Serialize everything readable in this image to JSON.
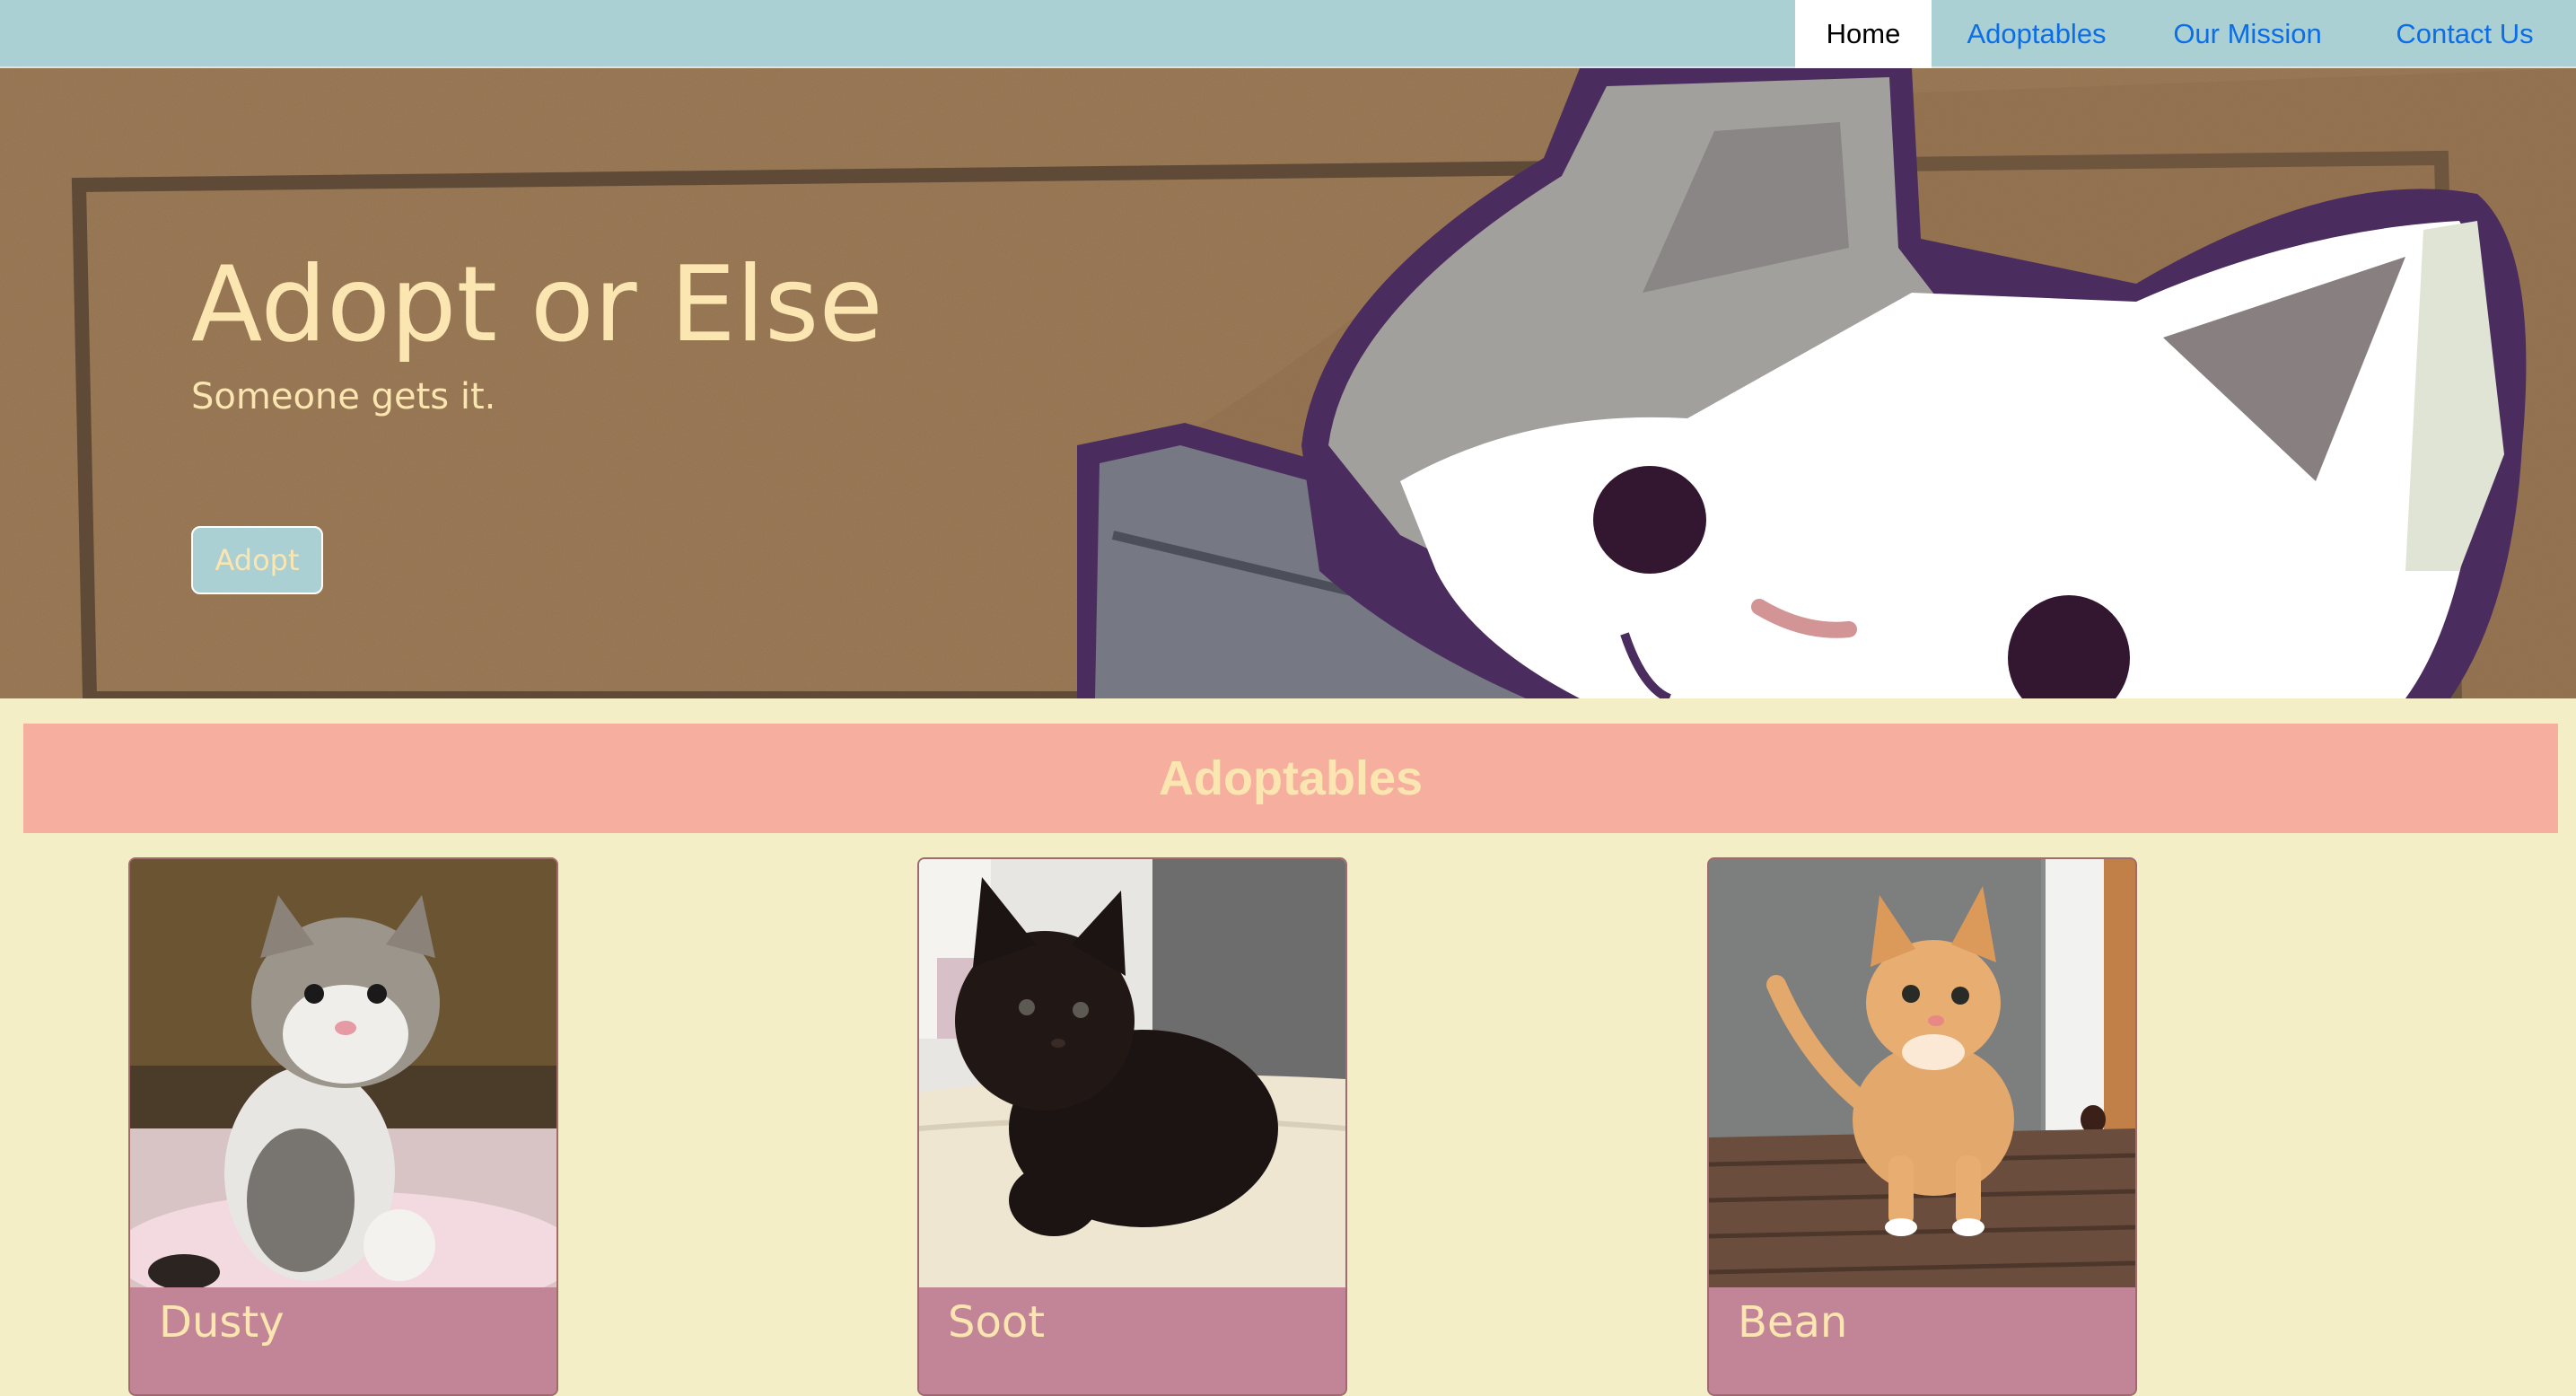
{
  "nav": {
    "items": [
      {
        "label": "Home",
        "active": true
      },
      {
        "label": "Adoptables",
        "active": false
      },
      {
        "label": "Our Mission",
        "active": false
      },
      {
        "label": "Contact Us",
        "active": false
      }
    ]
  },
  "hero": {
    "title": "Adopt or Else",
    "subtitle": "Someone gets it.",
    "button_label": "Adopt"
  },
  "adoptables": {
    "heading": "Adoptables",
    "cards": [
      {
        "name": "Dusty",
        "photo": "kitten-photo-gray-white"
      },
      {
        "name": "Soot",
        "photo": "kitten-photo-black"
      },
      {
        "name": "Bean",
        "photo": "kitten-photo-orange"
      }
    ]
  },
  "colors": {
    "nav_bg": "#abd0d4",
    "page_bg": "#f3eec6",
    "hero_text": "#fbe5b0",
    "section_header_bg": "#f6ae9f",
    "card_footer_bg": "#c28598",
    "link": "#0b6ee6"
  }
}
